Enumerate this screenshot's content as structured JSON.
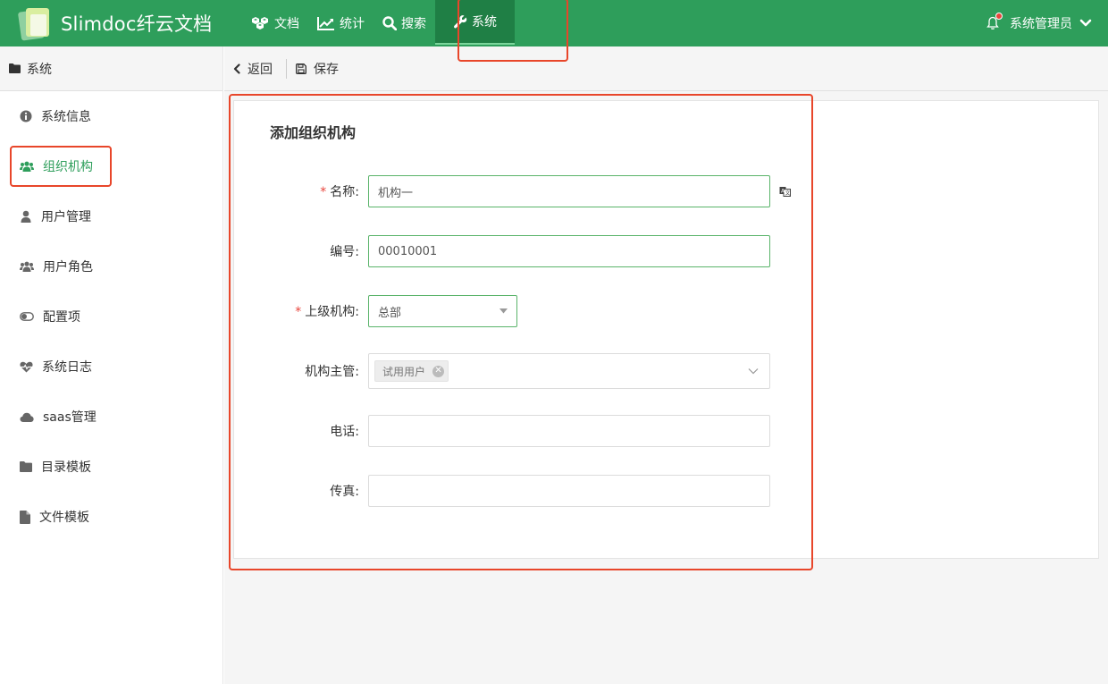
{
  "app": {
    "title": "Slimdoc纤云文档"
  },
  "nav": {
    "items": [
      {
        "label": "文档",
        "icon": "cubes-icon"
      },
      {
        "label": "统计",
        "icon": "line-chart-icon"
      },
      {
        "label": "搜索",
        "icon": "search-icon"
      },
      {
        "label": "系统",
        "icon": "wrench-icon",
        "active": true
      }
    ]
  },
  "user": {
    "name": "系统管理员",
    "has_notification": true
  },
  "sidebar": {
    "header": "系统",
    "items": [
      {
        "label": "系统信息",
        "icon": "info-circle-icon"
      },
      {
        "label": "组织机构",
        "icon": "users-icon",
        "active": true
      },
      {
        "label": "用户管理",
        "icon": "user-icon"
      },
      {
        "label": "用户角色",
        "icon": "users-icon"
      },
      {
        "label": "配置项",
        "icon": "toggle-icon"
      },
      {
        "label": "系统日志",
        "icon": "heartbeat-icon"
      },
      {
        "label": "saas管理",
        "icon": "cloud-icon"
      },
      {
        "label": "目录模板",
        "icon": "folder-icon"
      },
      {
        "label": "文件模板",
        "icon": "file-icon"
      }
    ]
  },
  "toolbar": {
    "back_label": "返回",
    "save_label": "保存"
  },
  "form": {
    "title": "添加组织机构",
    "name": {
      "label": "名称:",
      "value": "机构一",
      "required": true
    },
    "code": {
      "label": "编号:",
      "value": "00010001"
    },
    "parent": {
      "label": "上级机构:",
      "value": "总部",
      "required": true
    },
    "manager": {
      "label": "机构主管:",
      "tags": [
        "试用用户"
      ]
    },
    "phone": {
      "label": "电话:",
      "value": ""
    },
    "fax": {
      "label": "传真:",
      "value": ""
    }
  },
  "colors": {
    "brand": "#2e9e5b",
    "brand_dark": "#1f7f45",
    "highlight": "#e8462a",
    "required": "#e8453c"
  }
}
